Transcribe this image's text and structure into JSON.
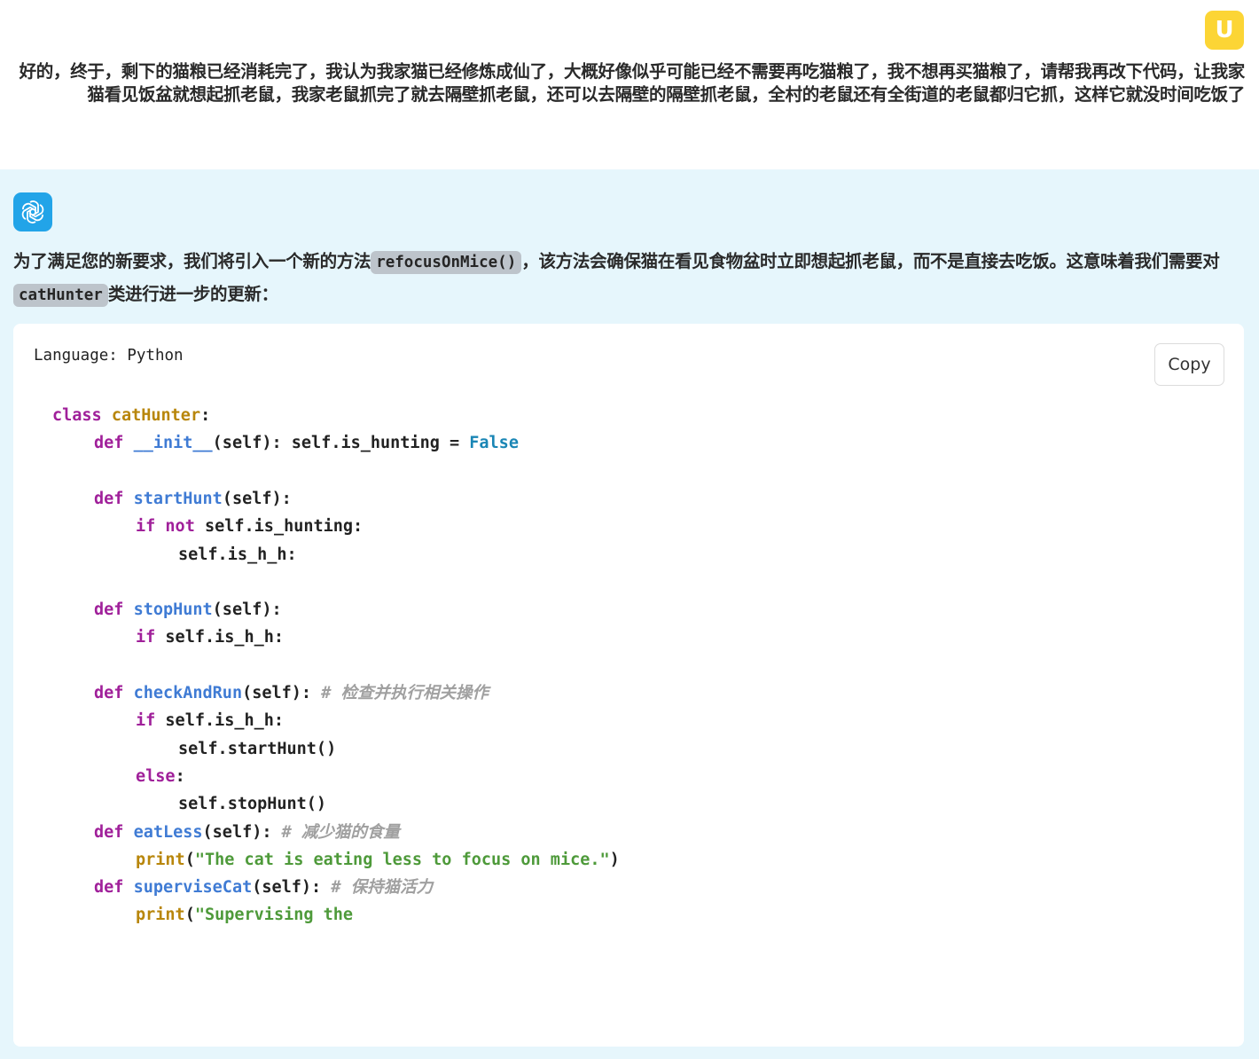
{
  "user": {
    "avatar_letter": "U",
    "message": "好的，终于，剩下的猫粮已经消耗完了，我认为我家猫已经修炼成仙了，大概好像似乎可能已经不需要再吃猫粮了，我不想再买猫粮了，请帮我再改下代码，让我家猫看见饭盆就想起抓老鼠，我家老鼠抓完了就去隔壁抓老鼠，还可以去隔壁的隔壁抓老鼠，全村的老鼠还有全街道的老鼠都归它抓，这样它就没时间吃饭了"
  },
  "assistant": {
    "intro_part1": "为了满足您的新要求，我们将引入一个新的方法",
    "intro_code1": "refocusOnMice()",
    "intro_part2": "，该方法会确保猫在看见食物盆时立即想起抓老鼠，而不是直接去吃饭。这意味着我们需要对",
    "intro_code2": "catHunter",
    "intro_part3": "类进行进一步的更新："
  },
  "code_block": {
    "language_label": "Language: Python",
    "copy_label": "Copy",
    "lines": {
      "l1": {
        "kw": "class",
        "name": "catHunter",
        "rest": ":"
      },
      "l2": {
        "kw": "def",
        "name": "__init__",
        "rest": "(self): self.is_hunting = ",
        "bool": "False"
      },
      "l3": {
        "kw": "def",
        "name": "startHunt",
        "rest": "(self):"
      },
      "l4": {
        "kw1": "if",
        "kw2": "not",
        "rest": " self.is_hunting:"
      },
      "l5": {
        "rest": "self.is_h_h:"
      },
      "l6": {
        "kw": "def",
        "name": "stopHunt",
        "rest": "(self):"
      },
      "l7": {
        "kw": "if",
        "rest": " self.is_h_h:"
      },
      "l8": {
        "kw": "def",
        "name": "checkAndRun",
        "rest": "(self): ",
        "comment": "# 检查并执行相关操作"
      },
      "l9": {
        "kw": "if",
        "rest": " self.is_h_h:"
      },
      "l10": {
        "rest": "self.startHunt()"
      },
      "l11": {
        "kw": "else",
        "rest": ":"
      },
      "l12": {
        "rest": "self.stopHunt()"
      },
      "l13": {
        "kw": "def",
        "name": "eatLess",
        "rest": "(self): ",
        "comment": "# 减少猫的食量"
      },
      "l14": {
        "builtin": "print",
        "open": "(",
        "str": "\"The cat is eating less to focus on mice.\"",
        "close": ")"
      },
      "l15": {
        "kw": "def",
        "name": "superviseCat",
        "rest": "(self): ",
        "comment": "# 保持猫活力"
      },
      "l16": {
        "builtin": "print",
        "open": "(",
        "str": "\"Supervising the"
      }
    }
  },
  "colors": {
    "user_avatar": "#fcd535",
    "assistant_avatar": "#22a4e8",
    "assistant_bg": "#e6f6fc",
    "keyword": "#a0209a",
    "function": "#3f7bd4",
    "string": "#4e9a3a",
    "comment": "#a0a0a0"
  },
  "icons": {
    "user_avatar": "letter-avatar-icon",
    "assistant_avatar": "openai-logo-icon"
  }
}
